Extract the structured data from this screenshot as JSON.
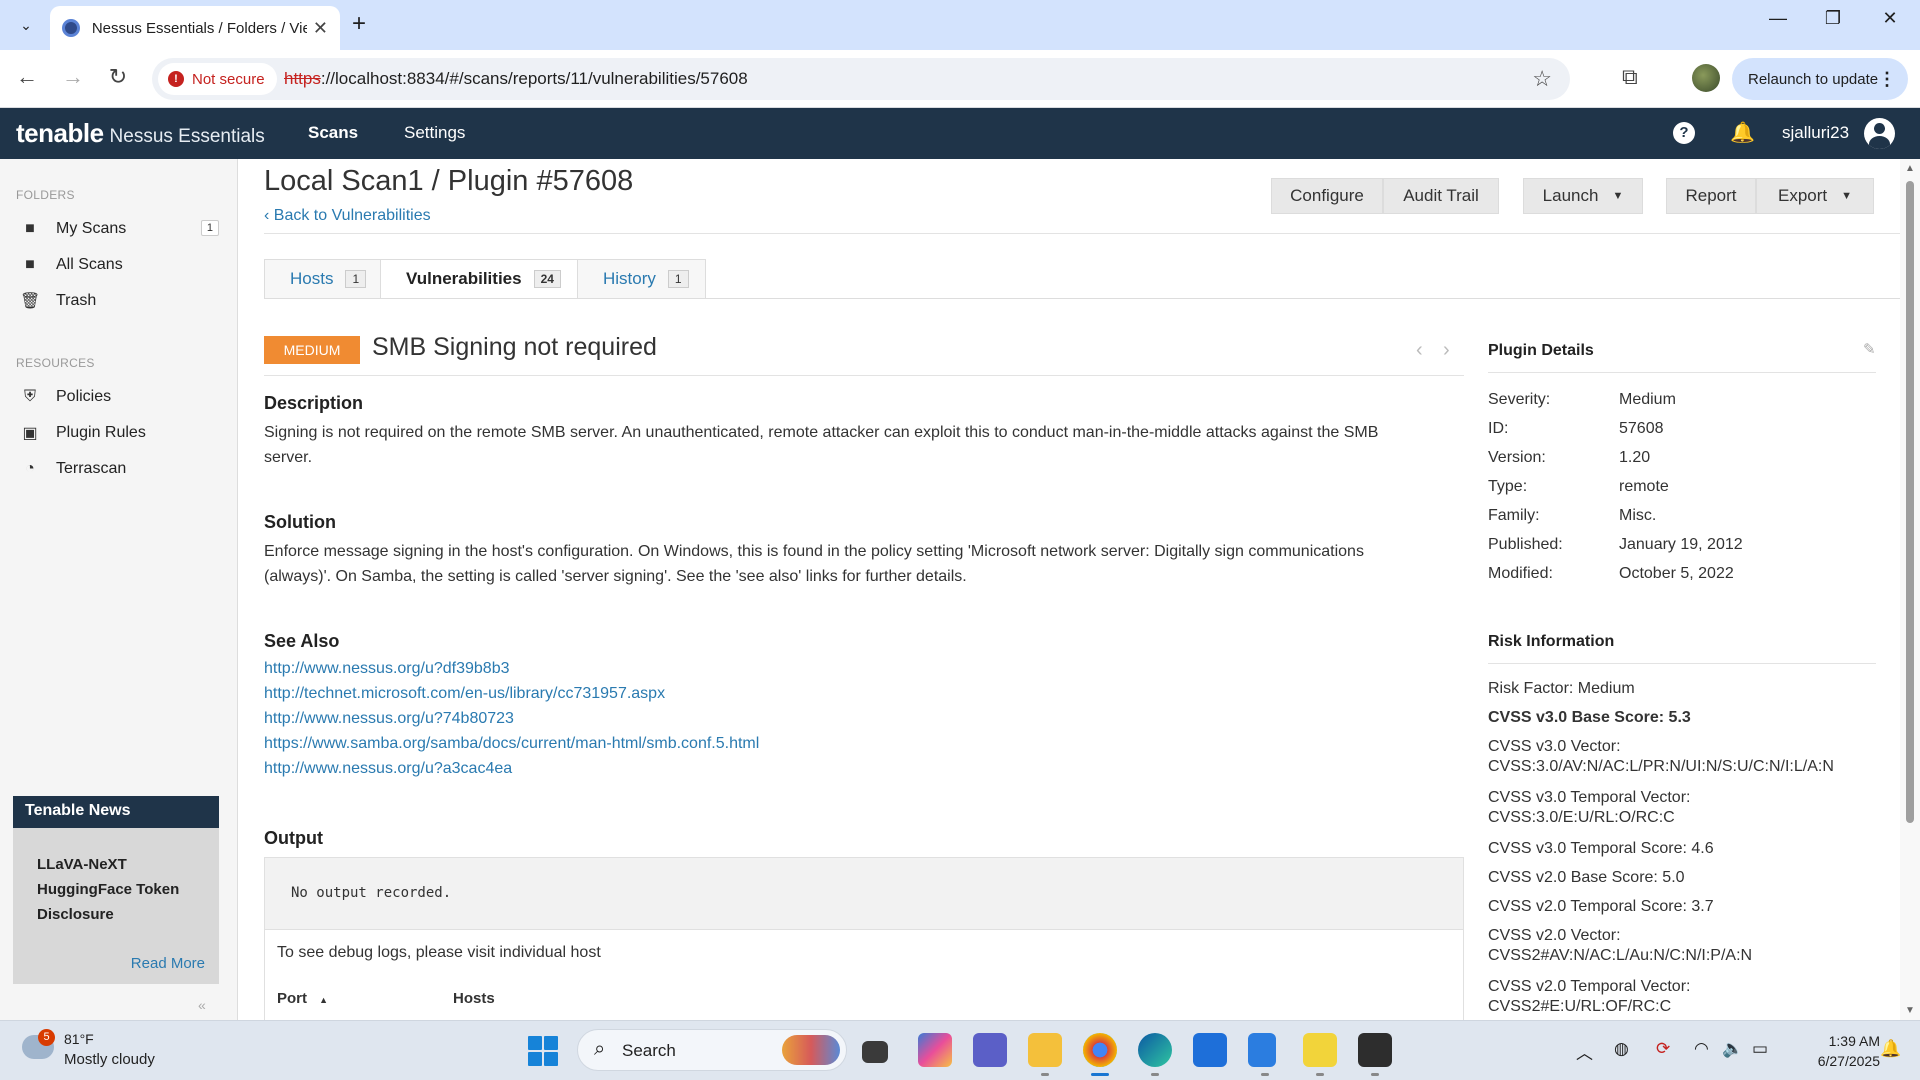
{
  "browser": {
    "tab_title": "Nessus Essentials / Folders / Vie",
    "security_label": "Not secure",
    "url_scheme": "https",
    "url_rest": "://localhost:8834/#/scans/reports/11/vulnerabilities/57608",
    "relaunch_label": "Relaunch to update"
  },
  "header": {
    "logo": "tenable",
    "product": "Nessus Essentials",
    "nav": [
      "Scans",
      "Settings"
    ],
    "username": "sjalluri23"
  },
  "sidebar": {
    "folders_heading": "FOLDERS",
    "folders": [
      {
        "label": "My Scans",
        "count": "1",
        "icon": "folder-icon"
      },
      {
        "label": "All Scans",
        "icon": "folder-icon"
      },
      {
        "label": "Trash",
        "icon": "trash-icon"
      }
    ],
    "resources_heading": "RESOURCES",
    "resources": [
      {
        "label": "Policies",
        "icon": "shield-icon"
      },
      {
        "label": "Plugin Rules",
        "icon": "plugin-rules-icon"
      },
      {
        "label": "Terrascan",
        "icon": "terrascan-icon"
      }
    ],
    "news": {
      "heading": "Tenable News",
      "body": "LLaVA-NeXT HuggingFace Token Disclosure",
      "read_more": "Read More"
    }
  },
  "page": {
    "title": "Local Scan1 / Plugin #57608",
    "back_link": "Back to Vulnerabilities",
    "buttons": {
      "configure": "Configure",
      "audit_trail": "Audit Trail",
      "launch": "Launch",
      "report": "Report",
      "export": "Export"
    },
    "tabs": [
      {
        "label": "Hosts",
        "count": "1"
      },
      {
        "label": "Vulnerabilities",
        "count": "24"
      },
      {
        "label": "History",
        "count": "1"
      }
    ]
  },
  "vulnerability": {
    "severity": "MEDIUM",
    "severity_color": "#f08b32",
    "name": "SMB Signing not required",
    "description_heading": "Description",
    "description": "Signing is not required on the remote SMB server. An unauthenticated, remote attacker can exploit this to conduct man-in-the-middle attacks against the SMB server.",
    "solution_heading": "Solution",
    "solution": "Enforce message signing in the host's configuration. On Windows, this is found in the policy setting 'Microsoft network server: Digitally sign communications (always)'. On Samba, the setting is called 'server signing'. See the 'see also' links for further details.",
    "see_also_heading": "See Also",
    "see_also": [
      "http://www.nessus.org/u?df39b8b3",
      "http://technet.microsoft.com/en-us/library/cc731957.aspx",
      "http://www.nessus.org/u?74b80723",
      "https://www.samba.org/samba/docs/current/man-html/smb.conf.5.html",
      "http://www.nessus.org/u?a3cac4ea"
    ],
    "output_heading": "Output",
    "output_text": "No output recorded.",
    "output_note": "To see debug logs, please visit individual host",
    "columns": [
      "Port",
      "Hosts"
    ],
    "port_sort_indicator": "▲"
  },
  "plugin_details": {
    "heading": "Plugin Details",
    "rows": [
      {
        "label": "Severity:",
        "value": "Medium"
      },
      {
        "label": "ID:",
        "value": "57608"
      },
      {
        "label": "Version:",
        "value": "1.20"
      },
      {
        "label": "Type:",
        "value": "remote"
      },
      {
        "label": "Family:",
        "value": "Misc."
      },
      {
        "label": "Published:",
        "value": "January 19, 2012"
      },
      {
        "label": "Modified:",
        "value": "October 5, 2022"
      }
    ]
  },
  "risk_information": {
    "heading": "Risk Information",
    "risk_factor": "Risk Factor: Medium",
    "cvss3_base": "CVSS v3.0 Base Score: 5.3",
    "cvss3_vector_label": "CVSS v3.0 Vector:",
    "cvss3_vector": "CVSS:3.0/AV:N/AC:L/PR:N/UI:N/S:U/C:N/I:L/A:N",
    "cvss3_temporal_vector_label": "CVSS v3.0 Temporal Vector:",
    "cvss3_temporal_vector": "CVSS:3.0/E:U/RL:O/RC:C",
    "cvss3_temporal_score": "CVSS v3.0 Temporal Score: 4.6",
    "cvss2_base": "CVSS v2.0 Base Score: 5.0",
    "cvss2_temporal_score": "CVSS v2.0 Temporal Score: 3.7",
    "cvss2_vector_label": "CVSS v2.0 Vector:",
    "cvss2_vector": "CVSS2#AV:N/AC:L/Au:N/C:N/I:P/A:N",
    "cvss2_temporal_vector_label": "CVSS v2.0 Temporal Vector:",
    "cvss2_temporal_vector": "CVSS2#E:U/RL:OF/RC:C"
  },
  "taskbar": {
    "weather_alerts": "5",
    "temperature": "81°F",
    "weather": "Mostly cloudy",
    "search_placeholder": "Search",
    "time": "1:39 AM",
    "date": "6/27/2025"
  }
}
